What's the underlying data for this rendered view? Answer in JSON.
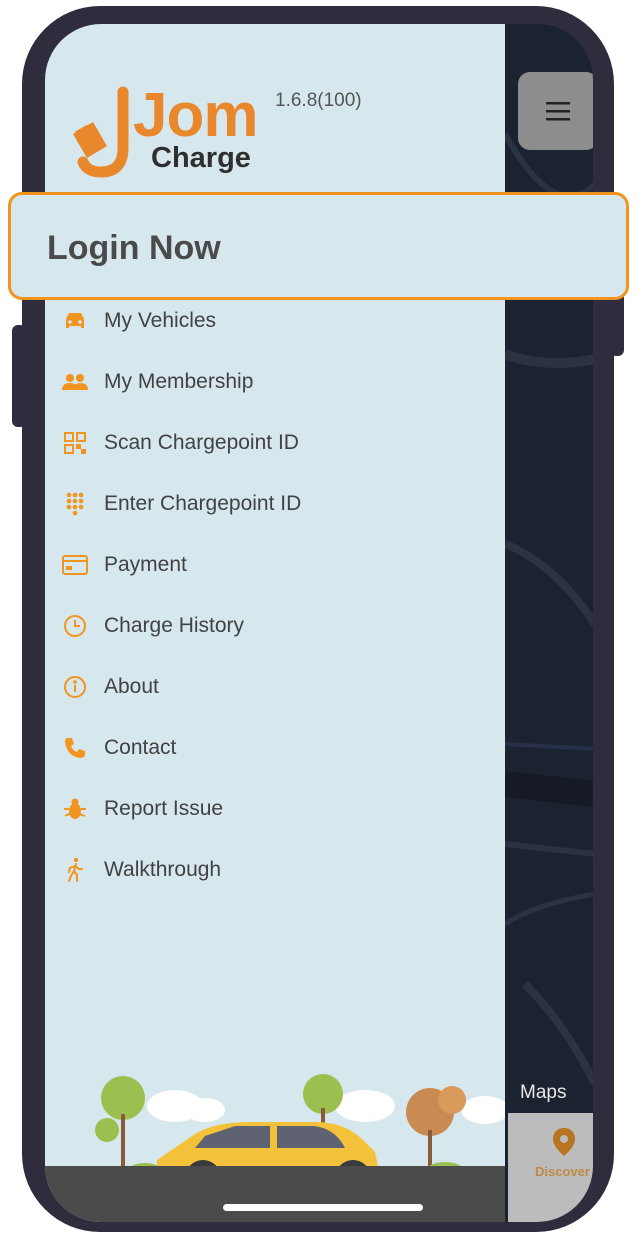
{
  "app": {
    "logo_word": "Jom",
    "logo_sub": "Charge",
    "version": "1.6.8(100)"
  },
  "login": {
    "label": "Login Now"
  },
  "menu": [
    {
      "label": "My Vehicles",
      "icon": "car-icon"
    },
    {
      "label": "My Membership",
      "icon": "people-icon"
    },
    {
      "label": "Scan Chargepoint ID",
      "icon": "qr-code-icon"
    },
    {
      "label": "Enter Chargepoint ID",
      "icon": "keypad-icon"
    },
    {
      "label": "Payment",
      "icon": "credit-card-icon"
    },
    {
      "label": "Charge History",
      "icon": "clock-icon"
    },
    {
      "label": "About",
      "icon": "info-icon"
    },
    {
      "label": "Contact",
      "icon": "phone-icon"
    },
    {
      "label": "Report Issue",
      "icon": "bug-icon"
    },
    {
      "label": "Walkthrough",
      "icon": "walking-person-icon"
    }
  ],
  "map": {
    "attribution": "Maps"
  },
  "tabbar": {
    "discover": "Discover"
  },
  "colors": {
    "accent": "#f2941d",
    "drawer": "#d6e8ee",
    "text": "#424242"
  }
}
